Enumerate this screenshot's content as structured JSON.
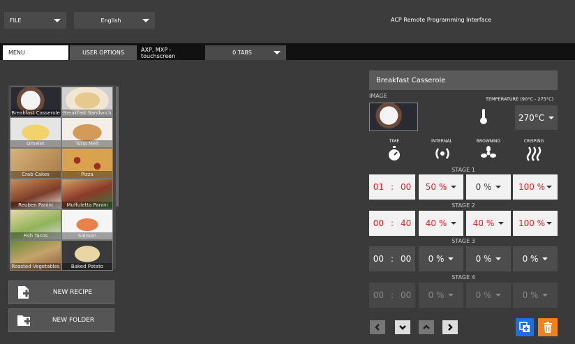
{
  "header": {
    "file_label": "FILE",
    "language": "English",
    "app_title": "ACP Remote Programming Interface"
  },
  "tabs": {
    "menu": "MENU",
    "user_options": "USER OPTIONS",
    "device": "AXP, MXP - touchscreen",
    "tabs_select": "0 TABS"
  },
  "recipes": [
    {
      "label": "Breakfast Casserole"
    },
    {
      "label": "Breakfast Sandwich"
    },
    {
      "label": "Omelet"
    },
    {
      "label": "Tuna Melt"
    },
    {
      "label": "Crab Cakes"
    },
    {
      "label": "Pizza"
    },
    {
      "label": "Reuben Panini"
    },
    {
      "label": "Muffuletta Panini"
    },
    {
      "label": "Fish Tacos"
    },
    {
      "label": "Salmon"
    },
    {
      "label": "Roasted Vegetables"
    },
    {
      "label": "Baked Potato"
    }
  ],
  "actions": {
    "new_recipe": "NEW RECIPE",
    "new_folder": "NEW FOLDER"
  },
  "recipe": {
    "name": "Breakfast Casserole",
    "image_label": "IMAGE",
    "temperature_label": "TEMPERATURE (90°C - 275°C)",
    "temperature_value": "270°C"
  },
  "columns": {
    "time": "TIME",
    "internal": "INTERNAL",
    "browning": "BROWNING",
    "crisping": "CRISPING"
  },
  "stages": [
    {
      "label": "STAGE 1",
      "min": "01",
      "sec": "00",
      "internal": "50 %",
      "browning": "0 %",
      "crisping": "100 %"
    },
    {
      "label": "STAGE 2",
      "min": "00",
      "sec": "40",
      "internal": "40 %",
      "browning": "40 %",
      "crisping": "100 %"
    },
    {
      "label": "STAGE 3",
      "min": "00",
      "sec": "00",
      "internal": "0 %",
      "browning": "0 %",
      "crisping": "0 %"
    },
    {
      "label": "STAGE 4",
      "min": "00",
      "sec": "00",
      "internal": "0 %",
      "browning": "0 %",
      "crisping": "0 %"
    }
  ],
  "time_separator": ":",
  "colors": {
    "accent_blue": "#1f6fe0",
    "accent_orange": "#f0821e",
    "active_red": "#d22222"
  }
}
